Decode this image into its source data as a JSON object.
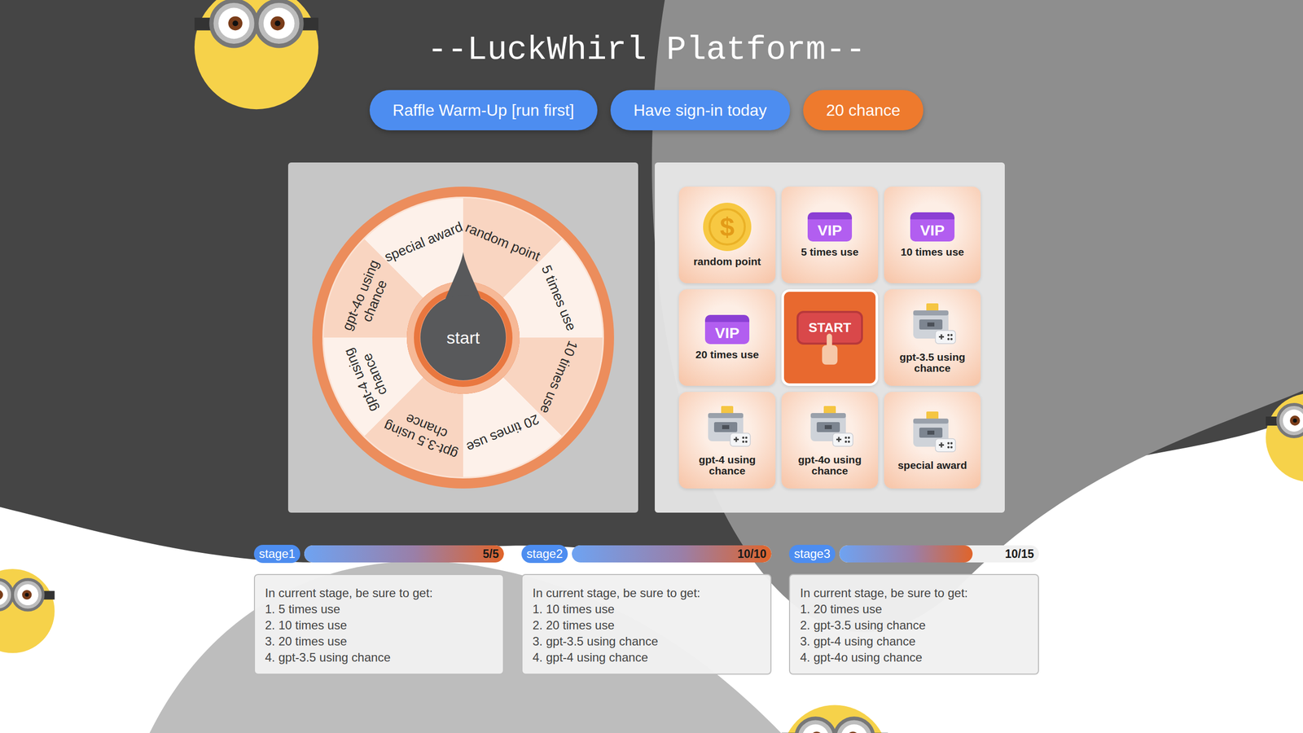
{
  "title": "--LuckWhirl Platform--",
  "actions": [
    {
      "label": "Raffle Warm-Up [run first]",
      "kind": "primary"
    },
    {
      "label": "Have sign-in today",
      "kind": "primary"
    },
    {
      "label": "20 chance",
      "kind": "highlight"
    }
  ],
  "wheel": {
    "button": "start",
    "segments": [
      "random point",
      "5 times use",
      "10 times use",
      "20 times use",
      "gpt-3.5 using chance",
      "gpt-4 using chance",
      "gpt-4o using chance",
      "special award"
    ]
  },
  "grid": {
    "cells": [
      {
        "label": "random point",
        "kind": "coin",
        "icon_text": "$"
      },
      {
        "label": "5 times use",
        "kind": "vip",
        "icon_text": "VIP"
      },
      {
        "label": "10 times use",
        "kind": "vip",
        "icon_text": "VIP"
      },
      {
        "label": "20 times use",
        "kind": "vip",
        "icon_text": "VIP"
      },
      {
        "label": "START",
        "kind": "start",
        "icon_text": ""
      },
      {
        "label": "gpt-3.5 using chance",
        "kind": "console",
        "icon_text": ""
      },
      {
        "label": "gpt-4 using chance",
        "kind": "console",
        "icon_text": ""
      },
      {
        "label": "gpt-4o using chance",
        "kind": "console",
        "icon_text": ""
      },
      {
        "label": "special award",
        "kind": "console",
        "icon_text": ""
      }
    ]
  },
  "stages": [
    {
      "label": "stage1",
      "reading": "5/5",
      "level": 1,
      "intro": "In current stage, be sure to get:",
      "items": [
        "1. 5 times use",
        "2. 10 times use",
        "3. 20 times use",
        "4. gpt-3.5 using chance"
      ]
    },
    {
      "label": "stage2",
      "reading": "10/10",
      "level": 1,
      "intro": "In current stage, be sure to get:",
      "items": [
        "1. 10 times use",
        "2. 20 times use",
        "3. gpt-3.5 using chance",
        "4. gpt-4 using chance"
      ]
    },
    {
      "label": "stage3",
      "reading": "10/15",
      "level": 0.667,
      "intro": "In current stage, be sure to get:",
      "items": [
        "1. 20 times use",
        "2. gpt-3.5 using chance",
        "3. gpt-4 using chance",
        "4. gpt-4o using chance"
      ]
    }
  ]
}
